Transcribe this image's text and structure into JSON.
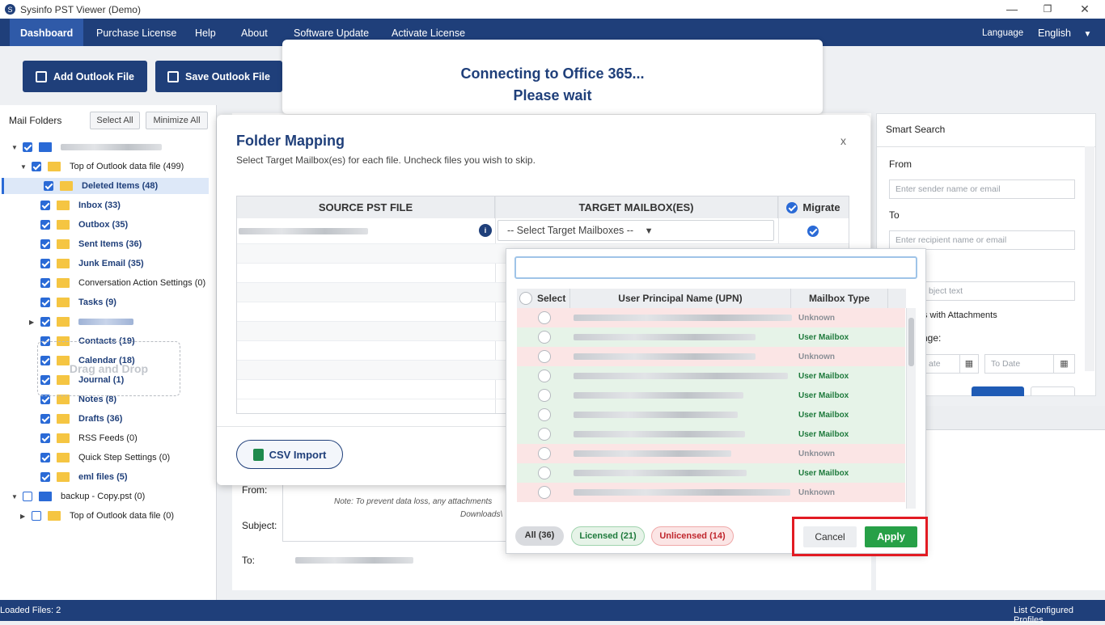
{
  "window": {
    "title": "Sysinfo PST Viewer (Demo)"
  },
  "menu": {
    "items": [
      "Dashboard",
      "Purchase License",
      "Help",
      "About",
      "Software Update",
      "Activate License"
    ],
    "language_label": "Language",
    "language_value": "English"
  },
  "toolbar": {
    "add_label": "Add Outlook File",
    "save_label": "Save Outlook File"
  },
  "folders": {
    "header": "Mail Folders",
    "select_all": "Select All",
    "minimize_all": "Minimize All",
    "items": [
      {
        "label": "Top of Outlook data file (499)",
        "bold": false
      },
      {
        "label": "Deleted Items (48)",
        "bold": true
      },
      {
        "label": "Inbox (33)",
        "bold": true
      },
      {
        "label": "Outbox (35)",
        "bold": true
      },
      {
        "label": "Sent Items (36)",
        "bold": true
      },
      {
        "label": "Junk Email (35)",
        "bold": true
      },
      {
        "label": "Conversation Action Settings (0)",
        "bold": false
      },
      {
        "label": "Tasks (9)",
        "bold": true
      },
      {
        "label": "Contacts (19)",
        "bold": true
      },
      {
        "label": "Calendar (18)",
        "bold": true
      },
      {
        "label": "Journal (1)",
        "bold": true
      },
      {
        "label": "Notes (8)",
        "bold": true
      },
      {
        "label": "Drafts (36)",
        "bold": true
      },
      {
        "label": "RSS Feeds (0)",
        "bold": false
      },
      {
        "label": "Quick Step Settings (0)",
        "bold": false
      },
      {
        "label": "eml files (5)",
        "bold": true
      },
      {
        "label": "backup - Copy.pst (0)",
        "bold": false
      },
      {
        "label": "Top of Outlook data file (0)",
        "bold": false
      }
    ],
    "drag_drop": "Drag and Drop"
  },
  "connecting": {
    "line1": "Connecting to Office 365...",
    "line2": "Please wait"
  },
  "mapping": {
    "title": "Folder Mapping",
    "subtitle": "Select Target Mailbox(es) for each file. Uncheck files you wish to skip.",
    "close": "x",
    "col_source": "SOURCE PST FILE",
    "col_target": "TARGET MAILBOX(ES)",
    "col_migrate": "Migrate",
    "select_placeholder": "-- Select Target Mailboxes --",
    "csv_button": "CSV Import"
  },
  "upn": {
    "col_select": "Select",
    "col_upn": "User Principal Name (UPN)",
    "col_type": "Mailbox Type",
    "rows": [
      {
        "type": "Unknown"
      },
      {
        "type": "User Mailbox"
      },
      {
        "type": "Unknown"
      },
      {
        "type": "User Mailbox"
      },
      {
        "type": "User Mailbox"
      },
      {
        "type": "User Mailbox"
      },
      {
        "type": "User Mailbox"
      },
      {
        "type": "Unknown"
      },
      {
        "type": "User Mailbox"
      },
      {
        "type": "Unknown"
      }
    ],
    "filter_all": "All (36)",
    "filter_licensed": "Licensed (21)",
    "filter_unlicensed": "Unlicensed (14)",
    "cancel": "Cancel",
    "apply": "Apply"
  },
  "smart_search": {
    "title": "Smart Search",
    "from_label": "From",
    "from_placeholder": "Enter sender name or email",
    "to_label": "To",
    "to_placeholder": "Enter recipient name or email",
    "subject_placeholder_partial": "bject text",
    "attachments_partial": "s with Attachments",
    "range_partial": "nge:",
    "date_from_partial": "ate",
    "date_to": "To Date"
  },
  "background": {
    "from_label": "From:",
    "subject_label": "Subject:",
    "to_label": "To:",
    "note_line1": "Note: To prevent data loss, any attachments",
    "note_line2": "Downloads\\"
  },
  "status": {
    "loaded": "Loaded Files: 2",
    "profiles": "List Configured Profiles"
  }
}
